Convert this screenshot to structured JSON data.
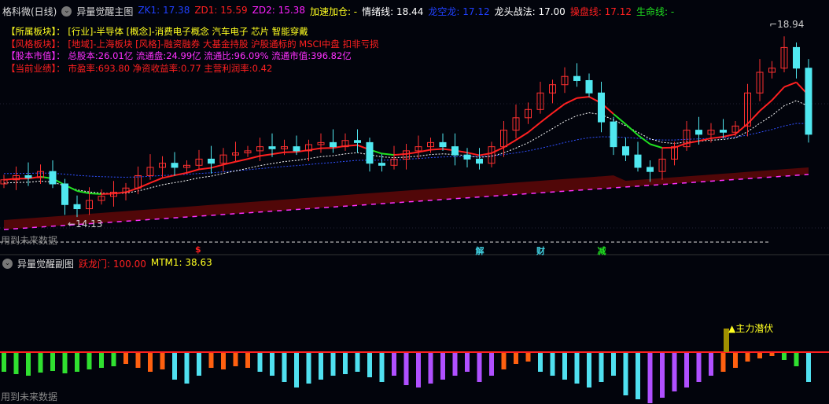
{
  "main_header": {
    "stock": "格科微(日线)",
    "indicator": "异量觉醒主图",
    "values": [
      {
        "label": "ZK1: 17.38",
        "color": "#2040ff"
      },
      {
        "label": "ZD1: 15.59",
        "color": "#ff2020"
      },
      {
        "label": "ZD2: 15.38",
        "color": "#ff20ff"
      },
      {
        "label": "加速加仓: -",
        "color": "#ffff20"
      },
      {
        "label": "情绪线: 18.44",
        "color": "#ffffff"
      },
      {
        "label": "龙空龙: 17.12",
        "color": "#2040ff"
      },
      {
        "label": "龙头战法: 17.00",
        "color": "#ffffff"
      },
      {
        "label": "操盘线: 17.12",
        "color": "#ff2020"
      },
      {
        "label": "生命线: -",
        "color": "#20e020"
      }
    ]
  },
  "info_lines": [
    {
      "label": "【所属板块】：",
      "text": "[行业]-半导体 [概念]-消费电子概念 汽车电子 芯片 智能穿戴",
      "color": "#ffff20"
    },
    {
      "label": "【风格板块】：",
      "text": "[地域]-上海板块 [风格]-融资融券 大基金持股 沪股通标的 MSCI中盘 扣非亏损",
      "color": "#ff2020"
    },
    {
      "label": "【股本市值】：",
      "text": "总股本:26.01亿 流通盘:24.99亿 流通比:96.09% 流通市值:396.82亿",
      "color": "#ff30ff"
    },
    {
      "label": "【当前业绩】：",
      "text": "市盈率:693.80 净资收益率:0.77 主营利润率:0.42",
      "color": "#ff2020"
    }
  ],
  "price_high": "18.94",
  "price_low": "14.13",
  "future_data_label": "用到未来数据",
  "event_markers": [
    {
      "text": "$",
      "color": "#ff2020",
      "index": 16
    },
    {
      "text": "解",
      "color": "#40d0e0",
      "index": 39
    },
    {
      "text": "财",
      "color": "#40d0e0",
      "index": 44
    },
    {
      "text": "减",
      "color": "#20e020",
      "index": 49
    }
  ],
  "sub_header": {
    "indicator": "异量觉醒副图",
    "values": [
      {
        "label": "跃龙门: 100.00",
        "color": "#ff2020"
      },
      {
        "label": "MTM1: 38.63",
        "color": "#ffff20"
      }
    ]
  },
  "sub_signal": "主力潜伏",
  "colors": {
    "up": "#ff3030",
    "down": "#50e8f0",
    "ma": "#ff2020"
  },
  "closes": [
    15.2,
    15.3,
    15.25,
    15.4,
    15.1,
    14.6,
    14.5,
    14.7,
    14.8,
    14.9,
    15.0,
    15.3,
    15.5,
    15.6,
    15.5,
    15.55,
    15.7,
    15.6,
    15.8,
    15.85,
    15.9,
    16.0,
    15.95,
    16.0,
    15.9,
    16.05,
    16.1,
    16.0,
    16.15,
    16.1,
    15.6,
    15.55,
    15.7,
    15.9,
    16.0,
    16.1,
    16.0,
    15.8,
    15.7,
    15.6,
    16.0,
    16.4,
    16.7,
    16.9,
    17.3,
    17.5,
    17.7,
    17.6,
    17.3,
    16.6,
    16.0,
    15.8,
    15.5,
    15.4,
    15.7,
    16.0,
    16.4,
    16.3,
    16.4,
    16.35,
    16.5,
    17.3,
    17.8,
    17.9,
    18.4,
    17.9,
    16.3
  ],
  "histogram": [
    {
      "v": -25,
      "c": "g"
    },
    {
      "v": -28,
      "c": "g"
    },
    {
      "v": -30,
      "c": "g"
    },
    {
      "v": -26,
      "c": "g"
    },
    {
      "v": -24,
      "c": "g"
    },
    {
      "v": -27,
      "c": "g"
    },
    {
      "v": -25,
      "c": "g"
    },
    {
      "v": -22,
      "c": "g"
    },
    {
      "v": -20,
      "c": "g"
    },
    {
      "v": -18,
      "c": "g"
    },
    {
      "v": -15,
      "c": "o"
    },
    {
      "v": -20,
      "c": "o"
    },
    {
      "v": -25,
      "c": "o"
    },
    {
      "v": -22,
      "c": "o"
    },
    {
      "v": -35,
      "c": "c"
    },
    {
      "v": -40,
      "c": "c"
    },
    {
      "v": -30,
      "c": "c"
    },
    {
      "v": -20,
      "c": "o"
    },
    {
      "v": -22,
      "c": "o"
    },
    {
      "v": -18,
      "c": "o"
    },
    {
      "v": -20,
      "c": "o"
    },
    {
      "v": -25,
      "c": "c"
    },
    {
      "v": -30,
      "c": "c"
    },
    {
      "v": -38,
      "c": "c"
    },
    {
      "v": -45,
      "c": "c"
    },
    {
      "v": -40,
      "c": "c"
    },
    {
      "v": -35,
      "c": "c"
    },
    {
      "v": -30,
      "c": "c"
    },
    {
      "v": -28,
      "c": "c"
    },
    {
      "v": -25,
      "c": "c"
    },
    {
      "v": -32,
      "c": "c"
    },
    {
      "v": -38,
      "c": "c"
    },
    {
      "v": -30,
      "c": "p"
    },
    {
      "v": -42,
      "c": "p"
    },
    {
      "v": -45,
      "c": "p"
    },
    {
      "v": -40,
      "c": "p"
    },
    {
      "v": -35,
      "c": "p"
    },
    {
      "v": -30,
      "c": "p"
    },
    {
      "v": -25,
      "c": "p"
    },
    {
      "v": -38,
      "c": "p"
    },
    {
      "v": -30,
      "c": "p"
    },
    {
      "v": -22,
      "c": "o"
    },
    {
      "v": -15,
      "c": "o"
    },
    {
      "v": -12,
      "c": "o"
    },
    {
      "v": -25,
      "c": "c"
    },
    {
      "v": -30,
      "c": "c"
    },
    {
      "v": -35,
      "c": "c"
    },
    {
      "v": -40,
      "c": "c"
    },
    {
      "v": -45,
      "c": "c"
    },
    {
      "v": -38,
      "c": "c"
    },
    {
      "v": -30,
      "c": "c"
    },
    {
      "v": -55,
      "c": "c"
    },
    {
      "v": -60,
      "c": "c"
    },
    {
      "v": -65,
      "c": "p"
    },
    {
      "v": -58,
      "c": "p"
    },
    {
      "v": -50,
      "c": "p"
    },
    {
      "v": -45,
      "c": "p"
    },
    {
      "v": -38,
      "c": "p"
    },
    {
      "v": -30,
      "c": "p"
    },
    {
      "v": -25,
      "c": "o"
    },
    {
      "v": -20,
      "c": "o"
    },
    {
      "v": -12,
      "c": "o"
    },
    {
      "v": -8,
      "c": "o"
    },
    {
      "v": -5,
      "c": "o"
    },
    {
      "v": -10,
      "c": "g"
    },
    {
      "v": -18,
      "c": "g"
    },
    {
      "v": -38,
      "c": "c"
    }
  ]
}
